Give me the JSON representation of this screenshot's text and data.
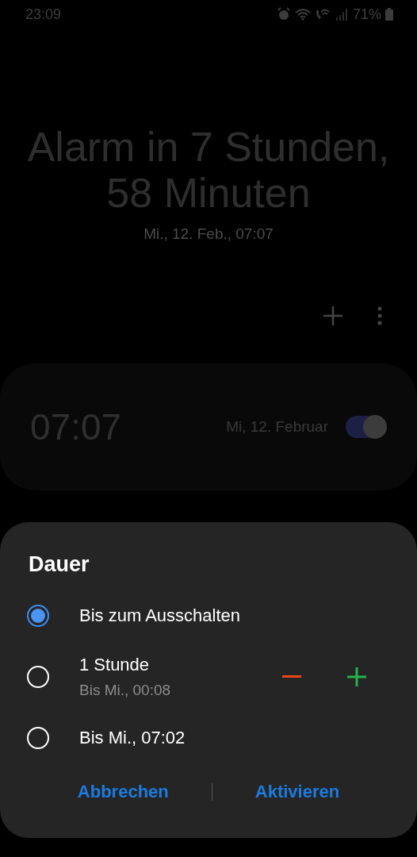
{
  "status_bar": {
    "time": "23:09",
    "battery": "71%"
  },
  "header": {
    "title": "Alarm in 7 Stunden, 58 Minuten",
    "subtitle": "Mi., 12. Feb., 07:07"
  },
  "alarms": [
    {
      "time": "07:07",
      "date": "Mi, 12. Februar",
      "on": true
    }
  ],
  "dialog": {
    "title": "Dauer",
    "options": [
      {
        "kind": "plain",
        "label": "Bis zum Ausschalten",
        "selected": true
      },
      {
        "kind": "stepper",
        "label": "1 Stunde",
        "detail": "Bis Mi., 00:08",
        "selected": false
      },
      {
        "kind": "plain",
        "label": "Bis Mi., 07:02",
        "selected": false
      }
    ],
    "buttons": [
      "Abbrechen",
      "Aktivieren"
    ]
  }
}
